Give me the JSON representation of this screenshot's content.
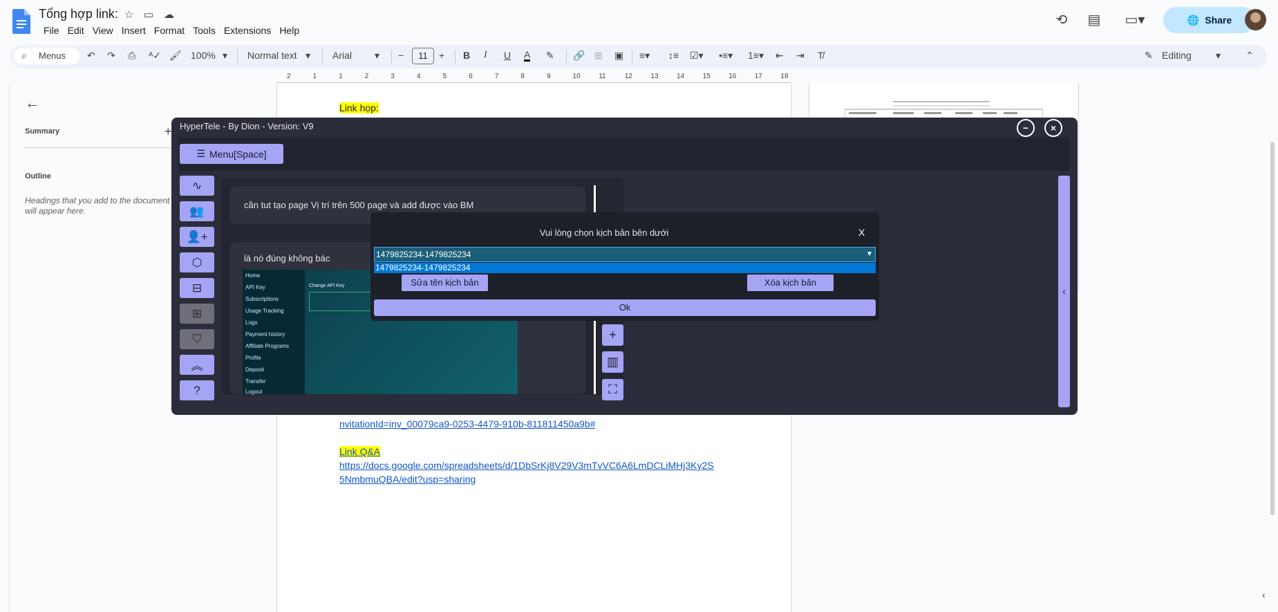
{
  "docs": {
    "title": "Tổng hợp link:",
    "menu": [
      "File",
      "Edit",
      "View",
      "Insert",
      "Format",
      "Tools",
      "Extensions",
      "Help"
    ],
    "share_label": "Share",
    "toolbar": {
      "search_label": "Menus",
      "zoom": "100%",
      "style": "Normal text",
      "font": "Arial",
      "font_size": "11",
      "mode": "Editing"
    },
    "ruler_ticks": [
      "2",
      "1",
      "1",
      "2",
      "3",
      "4",
      "5",
      "6",
      "7",
      "8",
      "9",
      "10",
      "11",
      "12",
      "13",
      "14",
      "15",
      "16",
      "17",
      "18"
    ],
    "sidebar": {
      "summary_label": "Summary",
      "outline_label": "Outline",
      "outline_hint": "Headings that you add to the document will appear here."
    },
    "body": {
      "heading1": "Link họp:",
      "link_tail": "nvitationId=inv_00079ca9-0253-4479-910b-811811450a9b#",
      "heading2": "Link Q&A",
      "qa_link_1": "https://docs.google.com/spreadsheets/d/1DbSrKj8V29V3mTvVC6A6LmDCLiMHj3Ky2S",
      "qa_link_2": "5NmbmuQBA/edit?usp=sharing"
    }
  },
  "hypertele": {
    "title": "HyperTele - By Dion - Version: V9",
    "menu_button": "Menu[Space]",
    "chat": {
      "message1": "cần tut tạo page Vị trí trên 500 page và add được vào BM",
      "message2": "là nó đúng không bác",
      "nav_items": [
        "Home",
        "API Key",
        "Subscriptions",
        "Usage Tracking",
        "Logs",
        "Payment history",
        "Affiliate Programs",
        "Profile",
        "Deposit",
        "Transfer",
        "Logout"
      ],
      "img_caption": "Change API Key"
    },
    "dialog": {
      "title": "Vui lòng chọn kịch bản bên dưới",
      "close": "X",
      "selected": "1479825234-1479825234",
      "option": "1479825234-1479825234",
      "rename_button": "Sửa tên kịch bản",
      "delete_button": "Xóa kịch bản",
      "ok_button": "Ok"
    }
  },
  "colors": {
    "accent": "#a5a4f5",
    "share_bg": "#c2e7ff",
    "window_bg": "#2b2d3a",
    "highlight": "#ffff00",
    "link": "#1155cc"
  }
}
